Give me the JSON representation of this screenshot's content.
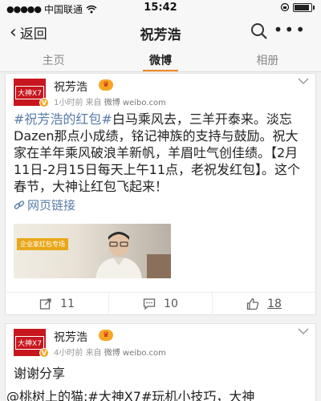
{
  "status_bar": {
    "carrier": "中国联通",
    "time": "15:42"
  },
  "nav": {
    "back_label": "返回",
    "title": "祝芳浩"
  },
  "tabs": [
    {
      "label": "主页",
      "active": false
    },
    {
      "label": "微博",
      "active": true
    },
    {
      "label": "相册",
      "active": false
    }
  ],
  "posts": [
    {
      "username": "祝芳浩",
      "avatar_text": "大神X7",
      "time": "1小时前",
      "source_prefix": "来自",
      "source": "微博 weibo.com",
      "topic": "#祝芳浩的红包#",
      "text_line1": "白马乘风去，三羊开泰",
      "text_rest": "来。淡忘Dazen那点小成绩，铭记神族的支持与鼓励。祝大家在羊年乘风破浪羊新帆，羊眉吐气创佳绩。【2月11日-2月15日每天上午11点，老祝发红包】。这个春节，大神让红包飞起来！",
      "link_label": "网页链接",
      "image_tag": "企业家红包专场",
      "reposts": "11",
      "comments": "10",
      "likes": "18"
    },
    {
      "username": "祝芳浩",
      "avatar_text": "大神X7",
      "time": "4小时前",
      "source_prefix": "来自",
      "source": "微博 weibo.com",
      "text": "谢谢分享"
    }
  ],
  "partial_line": "@桃树上的猫:#大神X7#玩机小技巧，大神",
  "colors": {
    "accent": "#f08a24",
    "link": "#5a7ca8",
    "brand_red": "#c8161e"
  }
}
